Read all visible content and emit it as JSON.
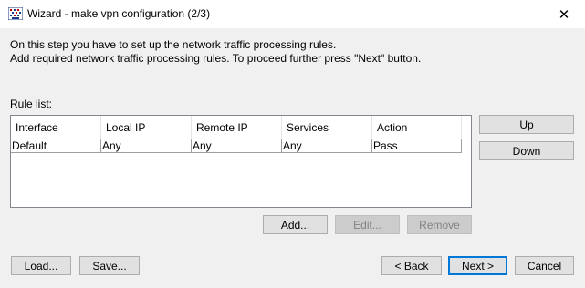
{
  "window": {
    "title": "Wizard - make vpn configuration (2/3)",
    "close_glyph": "✕"
  },
  "description": {
    "line1": "On this step you have to set up the network traffic processing rules.",
    "line2": "Add required network traffic processing rules. To proceed further press \"Next\" button."
  },
  "rules": {
    "label": "Rule list:",
    "columns": [
      "Interface",
      "Local IP",
      "Remote IP",
      "Services",
      "Action"
    ],
    "rows": [
      [
        "Default",
        "Any",
        "Any",
        "Any",
        "Pass"
      ]
    ]
  },
  "side_buttons": {
    "up": "Up",
    "down": "Down"
  },
  "list_buttons": {
    "add": "Add...",
    "edit": "Edit...",
    "remove": "Remove"
  },
  "footer_buttons": {
    "load": "Load...",
    "save": "Save...",
    "back": "< Back",
    "next": "Next >",
    "cancel": "Cancel"
  },
  "colors": {
    "accent": "#0078d7",
    "window_bg": "#f0f0f0"
  }
}
